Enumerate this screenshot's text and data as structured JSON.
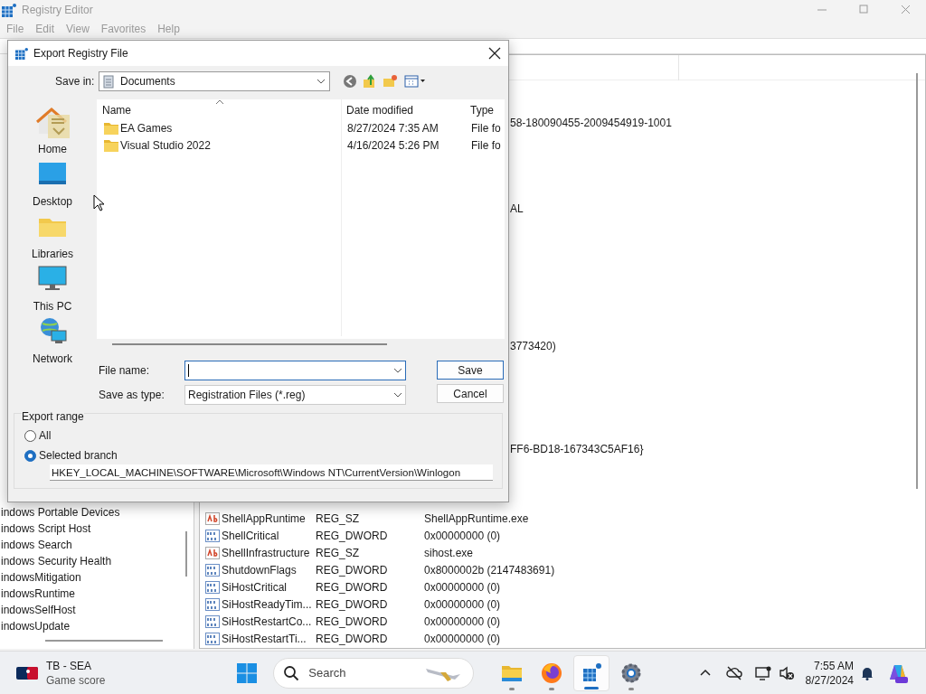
{
  "window": {
    "title": "Registry Editor"
  },
  "menu": [
    "File",
    "Edit",
    "View",
    "Favorites",
    "Help"
  ],
  "tree": {
    "items": [
      "indows Portable Devices",
      "indows Script Host",
      "indows Search",
      "indows Security Health",
      "indowsMitigation",
      "indowsRuntime",
      "indowsSelfHost",
      "indowsUpdate"
    ]
  },
  "values": {
    "partial_data": [
      "58-180090455-2009454919-1001",
      "AL",
      "3773420)",
      "FF6-BD18-167343C5AF16}"
    ],
    "rows": [
      {
        "kind": "string",
        "name": "ShellAppRuntime",
        "type": "REG_SZ",
        "data": "ShellAppRuntime.exe"
      },
      {
        "kind": "dword",
        "name": "ShellCritical",
        "type": "REG_DWORD",
        "data": "0x00000000 (0)"
      },
      {
        "kind": "string",
        "name": "ShellInfrastructure",
        "type": "REG_SZ",
        "data": "sihost.exe"
      },
      {
        "kind": "dword",
        "name": "ShutdownFlags",
        "type": "REG_DWORD",
        "data": "0x8000002b (2147483691)"
      },
      {
        "kind": "dword",
        "name": "SiHostCritical",
        "type": "REG_DWORD",
        "data": "0x00000000 (0)"
      },
      {
        "kind": "dword",
        "name": "SiHostReadyTim...",
        "type": "REG_DWORD",
        "data": "0x00000000 (0)"
      },
      {
        "kind": "dword",
        "name": "SiHostRestartCo...",
        "type": "REG_DWORD",
        "data": "0x00000000 (0)"
      },
      {
        "kind": "dword",
        "name": "SiHostRestartTi...",
        "type": "REG_DWORD",
        "data": "0x00000000 (0)"
      }
    ]
  },
  "dialog": {
    "title": "Export Registry File",
    "save_in": {
      "label": "Save in:",
      "value": "Documents"
    },
    "places": [
      {
        "kind": "home",
        "label": "Home"
      },
      {
        "kind": "desktop",
        "label": "Desktop"
      },
      {
        "kind": "libraries",
        "label": "Libraries"
      },
      {
        "kind": "pc",
        "label": "This PC"
      },
      {
        "kind": "network",
        "label": "Network"
      }
    ],
    "file_list": {
      "columns": [
        "Name",
        "Date modified",
        "Type"
      ],
      "rows": [
        {
          "name": "EA Games",
          "date": "8/27/2024 7:35 AM",
          "type": "File fo"
        },
        {
          "name": "Visual Studio 2022",
          "date": "4/16/2024 5:26 PM",
          "type": "File fo"
        }
      ]
    },
    "file_name": {
      "label": "File name:"
    },
    "save_as_type": {
      "label": "Save as type:",
      "value": "Registration Files (*.reg)"
    },
    "buttons": [
      "Save",
      "Cancel"
    ],
    "export_range": {
      "title": "Export range",
      "options": [
        {
          "label": "All",
          "selected": false
        },
        {
          "label": "Selected branch",
          "selected": true
        }
      ],
      "branch_path": "HKEY_LOCAL_MACHINE\\SOFTWARE\\Microsoft\\Windows NT\\CurrentVersion\\Winlogon"
    }
  },
  "taskbar": {
    "widget": {
      "title": "TB - SEA",
      "subtitle": "Game score"
    },
    "search": {
      "placeholder": "Search"
    },
    "apps": [
      {
        "kind": "explorer",
        "selected": false
      },
      {
        "kind": "firefox",
        "selected": false
      },
      {
        "kind": "regedit",
        "selected": true
      },
      {
        "kind": "settings",
        "selected": false
      }
    ],
    "clock": {
      "time": "7:55 AM",
      "date": "8/27/2024"
    }
  }
}
